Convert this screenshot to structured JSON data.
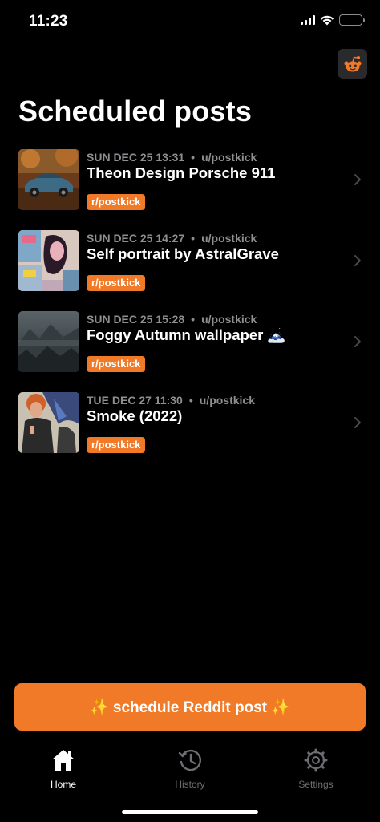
{
  "status_bar": {
    "time": "11:23"
  },
  "header": {
    "title": "Scheduled posts",
    "reddit_icon": "reddit-alien-icon"
  },
  "posts": [
    {
      "date": "SUN DEC 25 13:31",
      "user": "u/postkick",
      "title": "Theon Design Porsche 911",
      "subreddit": "r/postkick"
    },
    {
      "date": "SUN DEC 25 14:27",
      "user": "u/postkick",
      "title": "Self portrait by AstralGrave",
      "subreddit": "r/postkick"
    },
    {
      "date": "SUN DEC 25 15:28",
      "user": "u/postkick",
      "title": "Foggy Autumn wallpaper 🗻",
      "subreddit": "r/postkick"
    },
    {
      "date": "TUE DEC 27 11:30",
      "user": "u/postkick",
      "title": "Smoke (2022)",
      "subreddit": "r/postkick"
    }
  ],
  "cta": {
    "label": "✨ schedule Reddit post ✨"
  },
  "tabs": [
    {
      "label": "Home",
      "icon": "house-icon",
      "active": true
    },
    {
      "label": "History",
      "icon": "clock-history-icon",
      "active": false
    },
    {
      "label": "Settings",
      "icon": "gear-icon",
      "active": false
    }
  ],
  "colors": {
    "accent": "#f07a28",
    "background": "#000000",
    "muted": "#8e8e93"
  }
}
